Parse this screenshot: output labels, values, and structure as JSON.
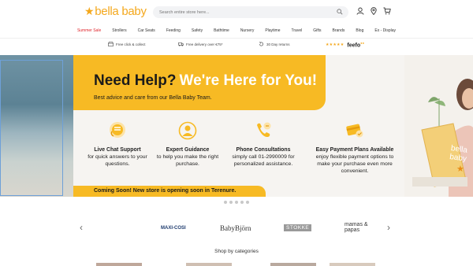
{
  "header": {
    "logo_text": "bella baby",
    "search_placeholder": "Search entire store here...",
    "icons": [
      "search-icon",
      "account-icon",
      "location-icon",
      "cart-icon"
    ]
  },
  "nav": {
    "items": [
      "Summer Sale",
      "Strollers",
      "Car Seats",
      "Feeding",
      "Safety",
      "Bathtime",
      "Nursery",
      "Playtime",
      "Travel",
      "Gifts",
      "Brands",
      "Blog",
      "Ex - Display"
    ]
  },
  "usp": {
    "click_collect": "Free click & collect",
    "delivery": "Free delivery over €75*",
    "returns": "30 Day returns",
    "feefo_stars": "★★★★★",
    "feefo_brand": "feefo"
  },
  "hero": {
    "title_dark": "Need Help?",
    "title_white": "We're Here for You!",
    "subtitle": "Best advice and care from our Bella Baby Team.",
    "features": [
      {
        "title": "Live Chat Support",
        "text": "for quick answers to your questions."
      },
      {
        "title": "Expert Guidance",
        "text": "to help you make the right purchase."
      },
      {
        "title": "Phone Consultations",
        "text": "simply call 01-2990009 for personalized assistance."
      },
      {
        "title": "Easy Payment Plans Available",
        "text": "enjoy flexible payment options to make your purchase even more convenient."
      }
    ],
    "banner": "Coming Soon!  New store is opening soon in Terenure.",
    "laptop_brand": "bella baby"
  },
  "carousel": {
    "dots": 5
  },
  "brands": [
    "MAXI-COSI",
    "BabyBjörn",
    "STOKKE",
    "mamas & papas"
  ],
  "shop_by_categories": "Shop by categories",
  "colors": {
    "brand_yellow": "#f7ba24",
    "sale_red": "#e0252b"
  }
}
